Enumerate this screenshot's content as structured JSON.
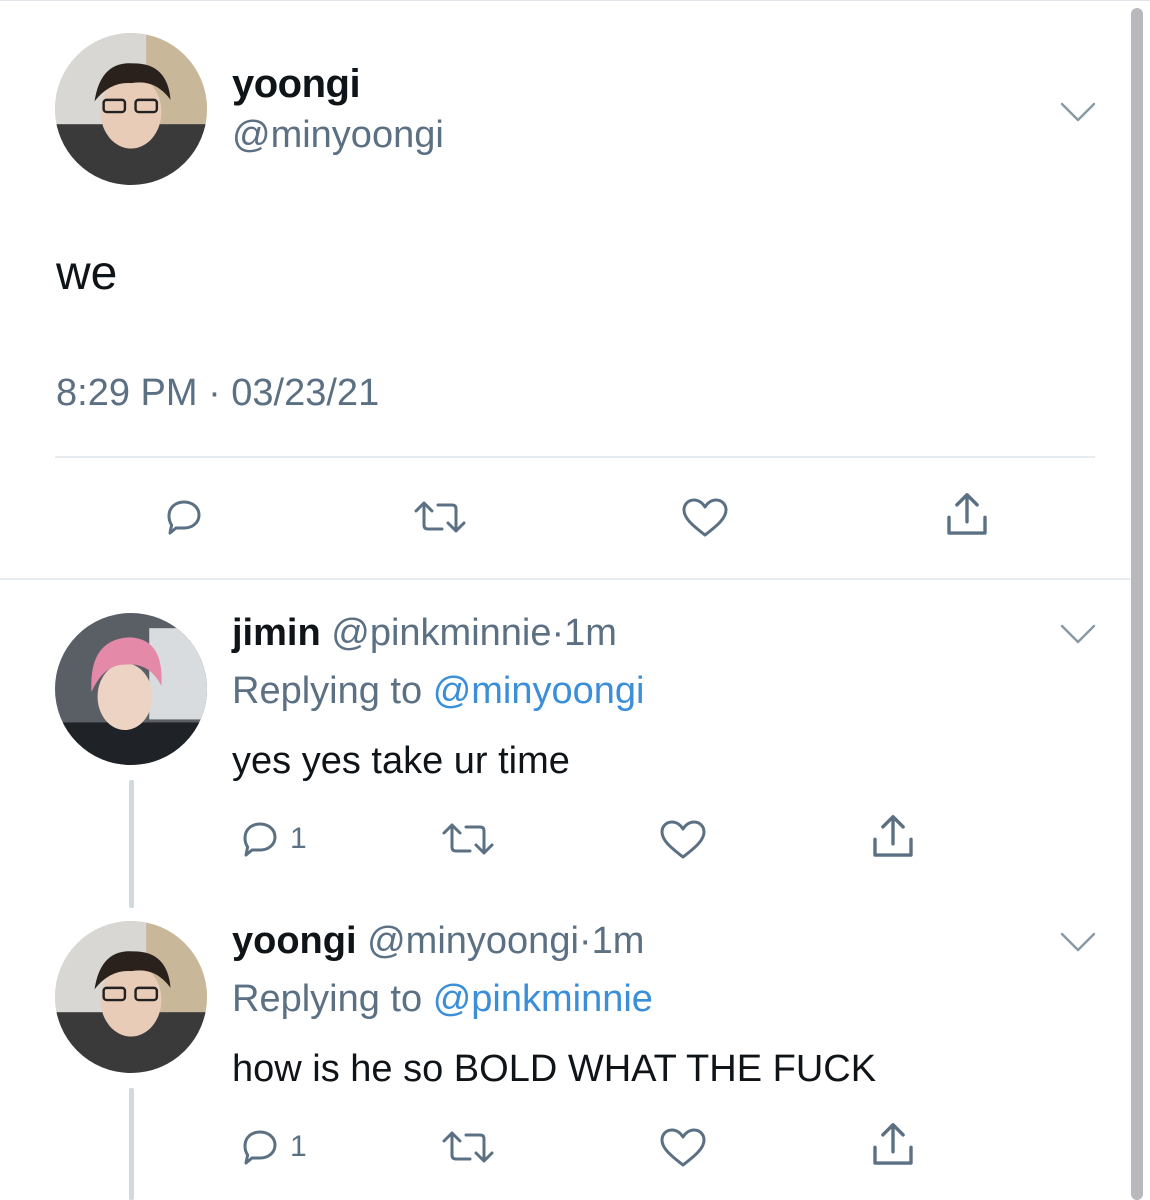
{
  "main_tweet": {
    "name": "yoongi",
    "handle": "@minyoongi",
    "text": "we",
    "timestamp": "8:29 PM · 03/23/21"
  },
  "replies": [
    {
      "name": "jimin",
      "handle": "@pinkminnie",
      "separator": "·",
      "time": "1m",
      "replying_prefix": "Replying to",
      "replying_to": "@minyoongi",
      "text": "yes yes take ur time",
      "reply_count": "1"
    },
    {
      "name": "yoongi",
      "handle": "@minyoongi",
      "separator": "·",
      "time": "1m",
      "replying_prefix": "Replying to",
      "replying_to": "@pinkminnie",
      "text": "how is he so BOLD WHAT THE FUCK",
      "reply_count": "1"
    }
  ],
  "icons": {
    "reply": "reply-icon",
    "retweet": "retweet-icon",
    "like": "heart-icon",
    "share": "share-icon",
    "more": "chevron-down-icon"
  },
  "colors": {
    "text": "#0f1419",
    "secondary": "#5b7083",
    "link": "#3b8ed8",
    "divider": "#e6ecf0"
  }
}
